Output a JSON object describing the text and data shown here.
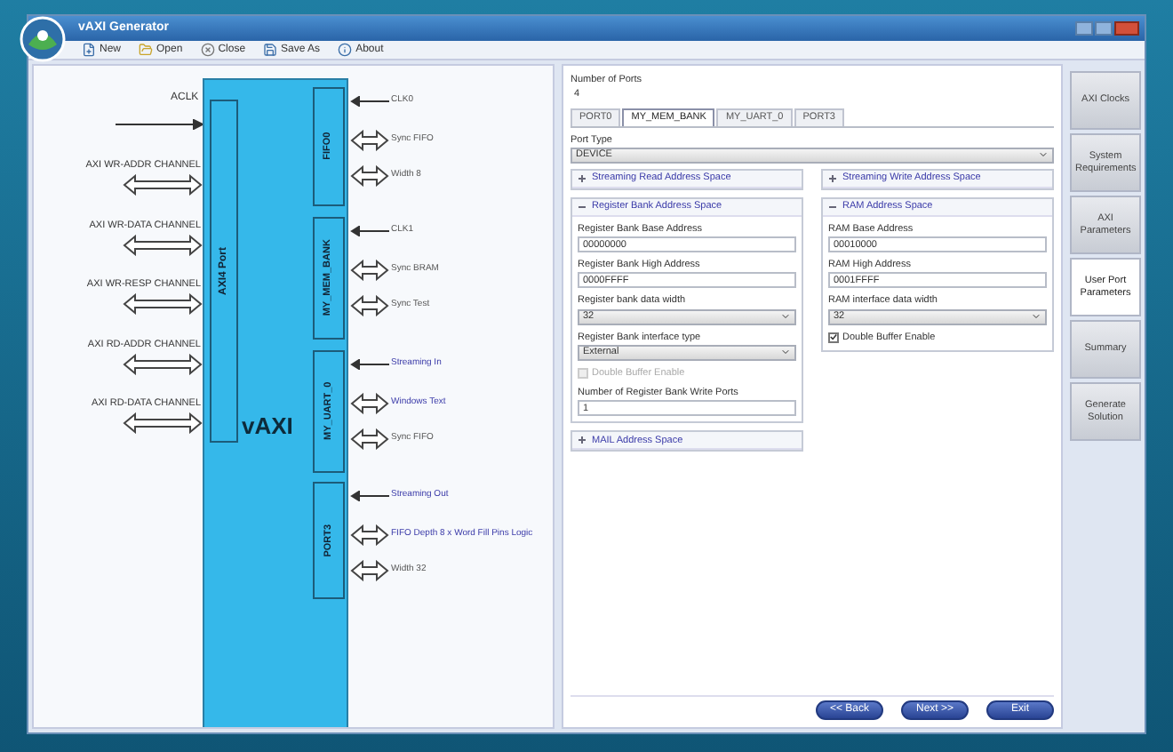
{
  "window": {
    "title": "vAXI Generator"
  },
  "toolbar": [
    {
      "kind": "new",
      "label": "New"
    },
    {
      "kind": "open",
      "label": "Open"
    },
    {
      "kind": "close",
      "label": "Close"
    },
    {
      "kind": "save",
      "label": "Save As"
    },
    {
      "kind": "about",
      "label": "About"
    }
  ],
  "diagram": {
    "clock": "ACLK",
    "core": "vAXI",
    "axi_port": "AXI4 Port",
    "channels": [
      "AXI WR-ADDR CHANNEL",
      "AXI WR-DATA CHANNEL",
      "AXI WR-RESP CHANNEL",
      "AXI RD-ADDR CHANNEL",
      "AXI RD-DATA CHANNEL"
    ],
    "ports": [
      {
        "name": "FIFO0",
        "signals": [
          {
            "kind": "in",
            "label": "CLK0",
            "highlighted": false
          },
          {
            "kind": "bidir",
            "label": "Sync FIFO",
            "highlighted": false
          },
          {
            "kind": "bidir",
            "label": "Width 8",
            "highlighted": false
          }
        ]
      },
      {
        "name": "MY_MEM_BANK",
        "signals": [
          {
            "kind": "in",
            "label": "CLK1",
            "highlighted": false
          },
          {
            "kind": "bidir",
            "label": "Sync BRAM",
            "highlighted": false
          },
          {
            "kind": "bidir",
            "label": "Sync Test",
            "highlighted": false
          }
        ]
      },
      {
        "name": "MY_UART_0",
        "signals": [
          {
            "kind": "in",
            "label": "Streaming In",
            "highlighted": true
          },
          {
            "kind": "bidir",
            "label": "Windows Text",
            "highlighted": true
          },
          {
            "kind": "bidir",
            "label": "Sync FIFO",
            "highlighted": false
          }
        ]
      },
      {
        "name": "PORT3",
        "signals": [
          {
            "kind": "in",
            "label": "Streaming Out",
            "highlighted": true
          },
          {
            "kind": "bidir",
            "label": "FIFO Depth 8 x Word Fill Pins Logic",
            "highlighted": true
          },
          {
            "kind": "bidir",
            "label": "Width 32",
            "highlighted": false
          }
        ]
      }
    ]
  },
  "form": {
    "ports_label": "Number of Ports",
    "ports_value": "4",
    "tabs": [
      {
        "label": "PORT0",
        "selected": false
      },
      {
        "label": "MY_MEM_BANK",
        "selected": true
      },
      {
        "label": "MY_UART_0",
        "selected": false
      },
      {
        "label": "PORT3",
        "selected": false
      }
    ],
    "port_type": {
      "label": "Port Type",
      "value": "DEVICE"
    },
    "left_sections": [
      {
        "title": "Streaming Read Address Space",
        "expanded": false
      },
      {
        "title": "Register Bank Address Space",
        "expanded": true,
        "fields": [
          {
            "kind": "text",
            "label": "Register Bank Base Address",
            "value": "00000000"
          },
          {
            "kind": "text",
            "label": "Register Bank High Address",
            "value": "0000FFFF"
          },
          {
            "kind": "select",
            "label": "Register bank data width",
            "value": "32"
          },
          {
            "kind": "select",
            "label": "Register Bank interface type",
            "value": "External"
          },
          {
            "kind": "check",
            "label": "Double Buffer Enable",
            "checked": false,
            "disabled": true
          },
          {
            "kind": "text",
            "label": "Number of Register Bank Write Ports",
            "value": "1"
          }
        ]
      },
      {
        "title": "MAIL Address Space",
        "expanded": false
      }
    ],
    "right_sections": [
      {
        "title": "Streaming Write Address Space",
        "expanded": false
      },
      {
        "title": "RAM Address Space",
        "expanded": true,
        "fields": [
          {
            "kind": "text",
            "label": "RAM Base Address",
            "value": "00010000"
          },
          {
            "kind": "text",
            "label": "RAM High Address",
            "value": "0001FFFF"
          },
          {
            "kind": "select",
            "label": "RAM interface data width",
            "value": "32"
          },
          {
            "kind": "check",
            "label": "Double Buffer Enable",
            "checked": true,
            "disabled": false
          }
        ]
      }
    ],
    "buttons": [
      "<< Back",
      "Next >>",
      "Exit"
    ]
  },
  "steps": [
    {
      "label": "AXI Clocks",
      "selected": false
    },
    {
      "label": "System Requirements",
      "selected": false
    },
    {
      "label": "AXI Parameters",
      "selected": false
    },
    {
      "label": "User Port Parameters",
      "selected": true
    },
    {
      "label": "Summary",
      "selected": false
    },
    {
      "label": "Generate Solution",
      "selected": false
    }
  ]
}
